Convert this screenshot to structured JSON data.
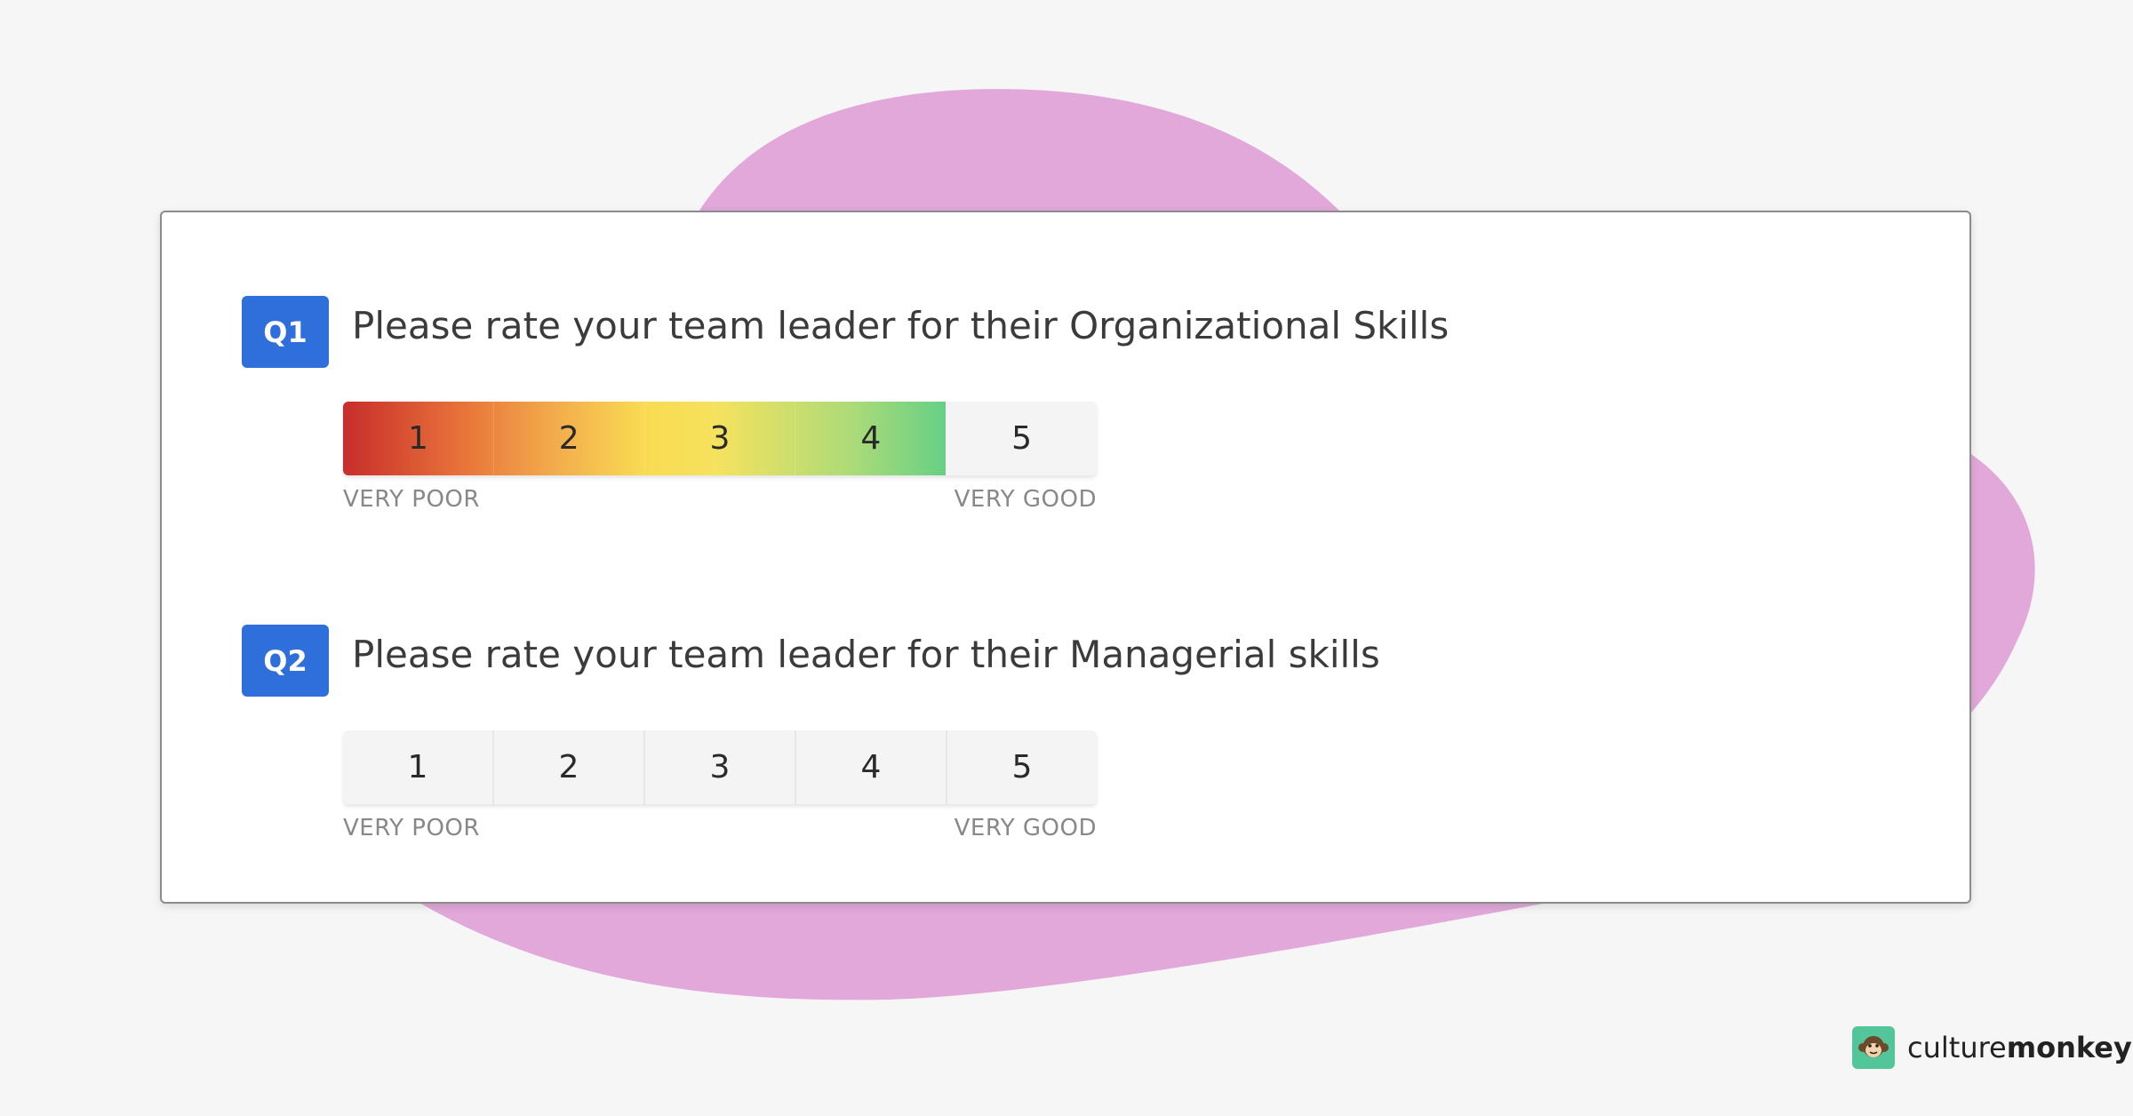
{
  "questions": [
    {
      "badge": "Q1",
      "text": "Please rate your team leader for their Organizational Skills",
      "options": [
        "1",
        "2",
        "3",
        "4",
        "5"
      ],
      "selected": 4,
      "low_label": "VERY POOR",
      "high_label": "VERY GOOD"
    },
    {
      "badge": "Q2",
      "text": "Please rate your team leader for their Managerial skills",
      "options": [
        "1",
        "2",
        "3",
        "4",
        "5"
      ],
      "selected": null,
      "low_label": "VERY POOR",
      "high_label": "VERY GOOD"
    }
  ],
  "brand": {
    "name_regular": "culture",
    "name_bold": "monkey",
    "logo_icon": "monkey-face-icon"
  },
  "colors": {
    "background": "#f6f6f6",
    "blob": "#e1a8d9",
    "badge": "#2f6fdb",
    "brand_logo": "#53c59a"
  }
}
